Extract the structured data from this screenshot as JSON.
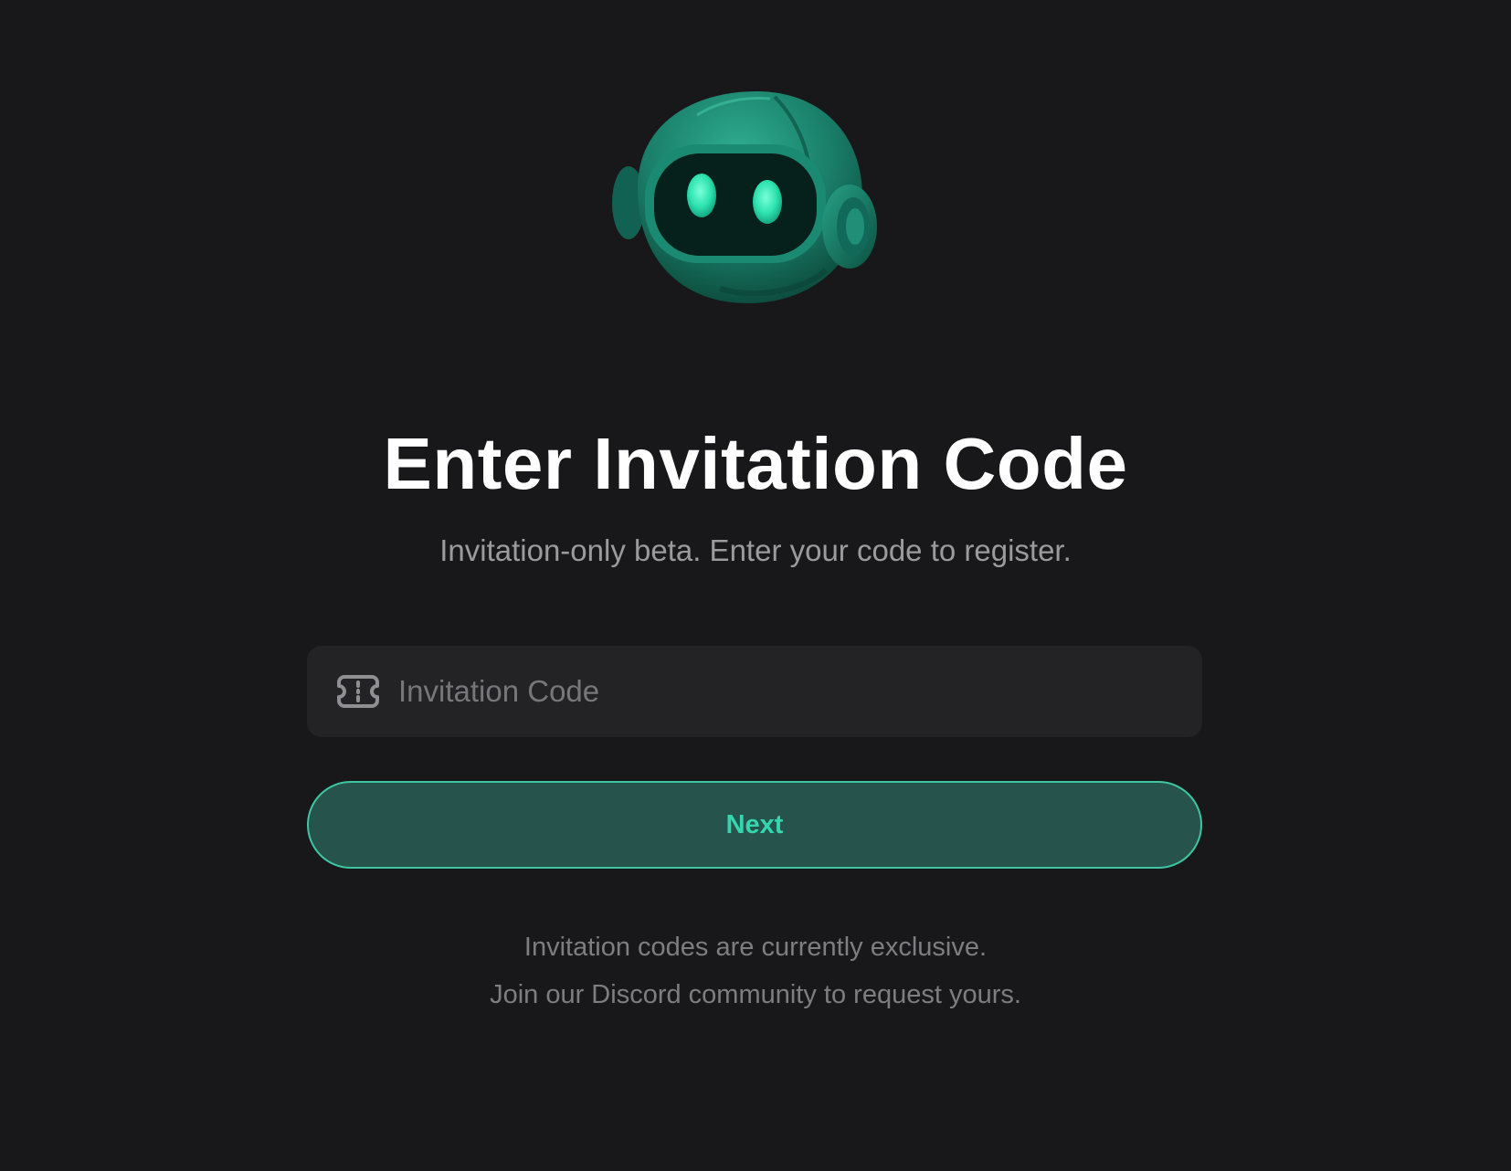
{
  "mascot": {
    "icon": "robot-mascot-icon",
    "colors": {
      "body": "#1f8f77",
      "visor": "#06201b",
      "eyes": "#2ee3b0"
    }
  },
  "header": {
    "title": "Enter Invitation Code",
    "subtitle": "Invitation-only beta. Enter your code to register."
  },
  "form": {
    "code_field": {
      "icon": "ticket-icon",
      "placeholder": "Invitation Code",
      "value": ""
    },
    "next_label": "Next"
  },
  "footer": {
    "line1": "Invitation codes are currently exclusive.",
    "line2": "Join our Discord community to request yours."
  },
  "colors": {
    "background": "#18181a",
    "field_background": "#232326",
    "button_background": "#26544d",
    "button_border": "#3ec6a3",
    "accent": "#35d6ad"
  }
}
